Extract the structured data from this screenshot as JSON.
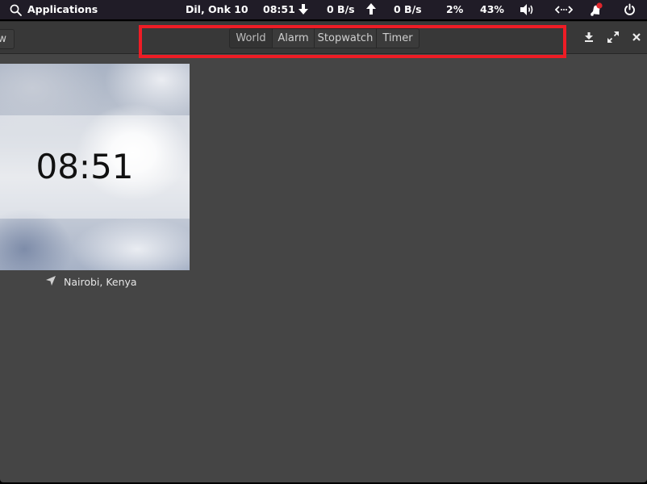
{
  "panel": {
    "applications_label": "Applications",
    "date": "Dil, Onk 10",
    "time": "08:51",
    "download_rate": "0  B/s",
    "upload_rate": "0  B/s",
    "cpu_percent": "2%",
    "memory_percent": "43%",
    "icons": {
      "search": "search-icon",
      "download": "arrow-down-icon",
      "upload": "arrow-up-icon",
      "volume": "volume-icon",
      "network": "network-wired-icon",
      "notifications": "notification-bell-icon",
      "power": "power-icon"
    },
    "notification_badge_color": "#e0262c"
  },
  "window": {
    "new_button_label": "w",
    "tabs": [
      {
        "label": "World",
        "active": true
      },
      {
        "label": "Alarm",
        "active": false
      },
      {
        "label": "Stopwatch",
        "active": false
      },
      {
        "label": "Timer",
        "active": false
      }
    ],
    "controls": {
      "unmaximize": "download-icon",
      "fullscreen": "fullscreen-icon",
      "close": "close-icon"
    },
    "highlight_color": "#ee1c25"
  },
  "world": {
    "clocks": [
      {
        "time": "08:51",
        "location": "Nairobi, Kenya",
        "is_current": true
      }
    ]
  }
}
